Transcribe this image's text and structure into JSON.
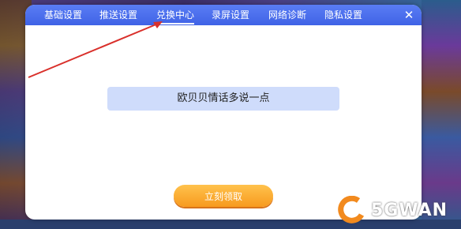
{
  "tabs": [
    {
      "label": "基础设置",
      "active": false
    },
    {
      "label": "推送设置",
      "active": false
    },
    {
      "label": "兑换中心",
      "active": true
    },
    {
      "label": "录屏设置",
      "active": false
    },
    {
      "label": "网络诊断",
      "active": false
    },
    {
      "label": "隐私设置",
      "active": false
    }
  ],
  "close_icon": "close-icon",
  "redeem": {
    "code_value": "欧贝贝情话多说一点",
    "button_label": "立刻领取"
  },
  "watermark": {
    "text": "5GWAN"
  },
  "colors": {
    "tabbar": "#4a6ff0",
    "code_box": "#cfdcfb",
    "button": "#f9a227",
    "annotation_arrow": "#d9302b"
  }
}
